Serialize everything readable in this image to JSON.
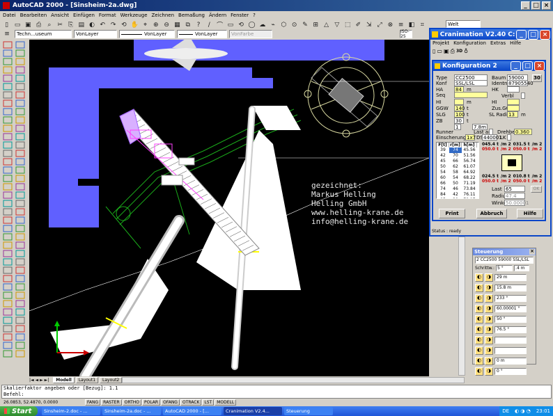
{
  "app": {
    "title": "AutoCAD 2000 - [Sinsheim-2a.dwg]"
  },
  "menubar": [
    "Datei",
    "Bearbeiten",
    "Ansicht",
    "Einfügen",
    "Format",
    "Werkzeuge",
    "Zeichnen",
    "Bemaßung",
    "Ändern",
    "Fenster",
    "?"
  ],
  "props": {
    "layer_combo": "Techn...useum",
    "color_combo": "VonLayer",
    "linetype_combo": "VonLayer",
    "lineweight_combo": "VonLayer",
    "plotstyle_combo": "VonFarbe",
    "dimstyle_combo": "ISO-25",
    "ucs_combo": "Welt"
  },
  "canvas": {
    "annotation": [
      "gezeichnet:",
      "Markus Helling",
      "Helling GmbH",
      "www.helling-krane.de",
      "info@helling-krane.de"
    ]
  },
  "layout_tabs": [
    "Modell",
    "Layout1",
    "Layout2"
  ],
  "command": {
    "line1": "Skalierfaktor angeben oder [Bezug]: 1.1",
    "line2": "Befehl:"
  },
  "status": {
    "coords": "26.0853, 52.4870, 0.0000",
    "toggles": [
      "FANG",
      "RASTER",
      "ORTHO",
      "POLAR",
      "OFANG",
      "OTRACK",
      "LST",
      "MODELL"
    ]
  },
  "cranimation": {
    "title": "Cranimation V2.40 C:\\Cr...",
    "menu": [
      "Projekt",
      "Konfiguration",
      "Extras",
      "Hilfe"
    ],
    "status": "Status : ready"
  },
  "konfig": {
    "title": "Konfiguration  2",
    "type_label": "Type",
    "type_value": "CC2500",
    "konf_label": "Konf",
    "konf_value": "SSL/LSL",
    "ha_label": "HA",
    "ha_value": "84",
    "ha_unit": "m",
    "seq_label": "Seq",
    "hi_label": "HI",
    "hi_unit": "m",
    "ggw_label": "GGW",
    "ggw_value": "140",
    "ggw_unit": "t",
    "slg_label": "SLG",
    "slg_value": "100",
    "slg_unit": "t",
    "zb_label": "ZB",
    "zb_value": "30",
    "zb_unit": "t",
    "runner_label": "Runner",
    "runner_value": "1",
    "runner_length": "7.8m",
    "einscherung_label": "Einscherung",
    "einscherung_value": "1x7",
    "ds_label": "DS",
    "baum_label": "Baum",
    "baum_value": "59000",
    "identnr_label": "Identnr",
    "identnr_value": "87905540",
    "hk_label": "HK",
    "verbl_label": "Verbl",
    "hi2_label": "HI",
    "zusggw_label": "Zus.GGW",
    "slradius_label": "SL Radius",
    "slradius_value": "13",
    "slradius_unit": "m",
    "lastan_label": "Last an",
    "drehber_label": "Drehber.",
    "drehber_value": "0.360",
    "ds_value": "440001",
    "lk_label": "LK",
    "badge": "30",
    "table": {
      "headers": [
        "F[t]",
        "r[m]",
        "h[m]"
      ],
      "rows": [
        [
          "39",
          "74",
          "45.56"
        ],
        [
          "42",
          "70",
          "51.56"
        ],
        [
          "45",
          "66",
          "56.74"
        ],
        [
          "50",
          "62",
          "61.07"
        ],
        [
          "54",
          "58",
          "64.92"
        ],
        [
          "60",
          "54",
          "68.22"
        ],
        [
          "66",
          "50",
          "71.19"
        ],
        [
          "74",
          "46",
          "73.84"
        ],
        [
          "84",
          "42",
          "76.11"
        ],
        [
          "95",
          "38",
          "78.17"
        ],
        [
          "107",
          "34",
          "79.99"
        ]
      ]
    },
    "loads": {
      "a1": "045.4 t",
      "a2": "/m 2",
      "a3": "031.5 t",
      "a4": "/m 2",
      "b1": "050.0 t",
      "b2": "/m 2",
      "b3": "050.0 t",
      "b4": "/m 2",
      "c1": "024.5 t",
      "c2": "/m 2",
      "c3": "010.8 t",
      "c4": "/m 2",
      "d1": "050.0 t",
      "d2": "/m 2",
      "d3": "050.0 t",
      "d4": "/m 2"
    },
    "last_label": "Last",
    "last_value": "65",
    "radius_label": "Radius",
    "radius_value": "47.4",
    "winkel_label": "Winkel",
    "winkel_value": "50.00001",
    "ok": "OK",
    "buttons": {
      "print": "Print",
      "abbruch": "Abbruch",
      "hilfe": "Hilfe"
    }
  },
  "steuerung": {
    "title": "Steuerung",
    "select": "2 CC2500     59000 SSL/LSL",
    "schrittw_label": "Schrittw.:",
    "schrittw_a": "5 °",
    "schrittw_b": ".4 m",
    "values": [
      "29 m",
      "15.8 m",
      "233 °",
      "60.00001 °",
      "50 °",
      "76.5 °",
      "",
      "",
      "0 m",
      "0 °"
    ]
  },
  "taskbar": {
    "start": "Start",
    "tasks": [
      "Sinsheim-2.doc - ...",
      "Sinsheim-2a.doc - ...",
      "AutoCAD 2000 - [...",
      "Cranimation V2.4...",
      "Steuerung"
    ],
    "lang": "DE",
    "clock": "23:01"
  }
}
